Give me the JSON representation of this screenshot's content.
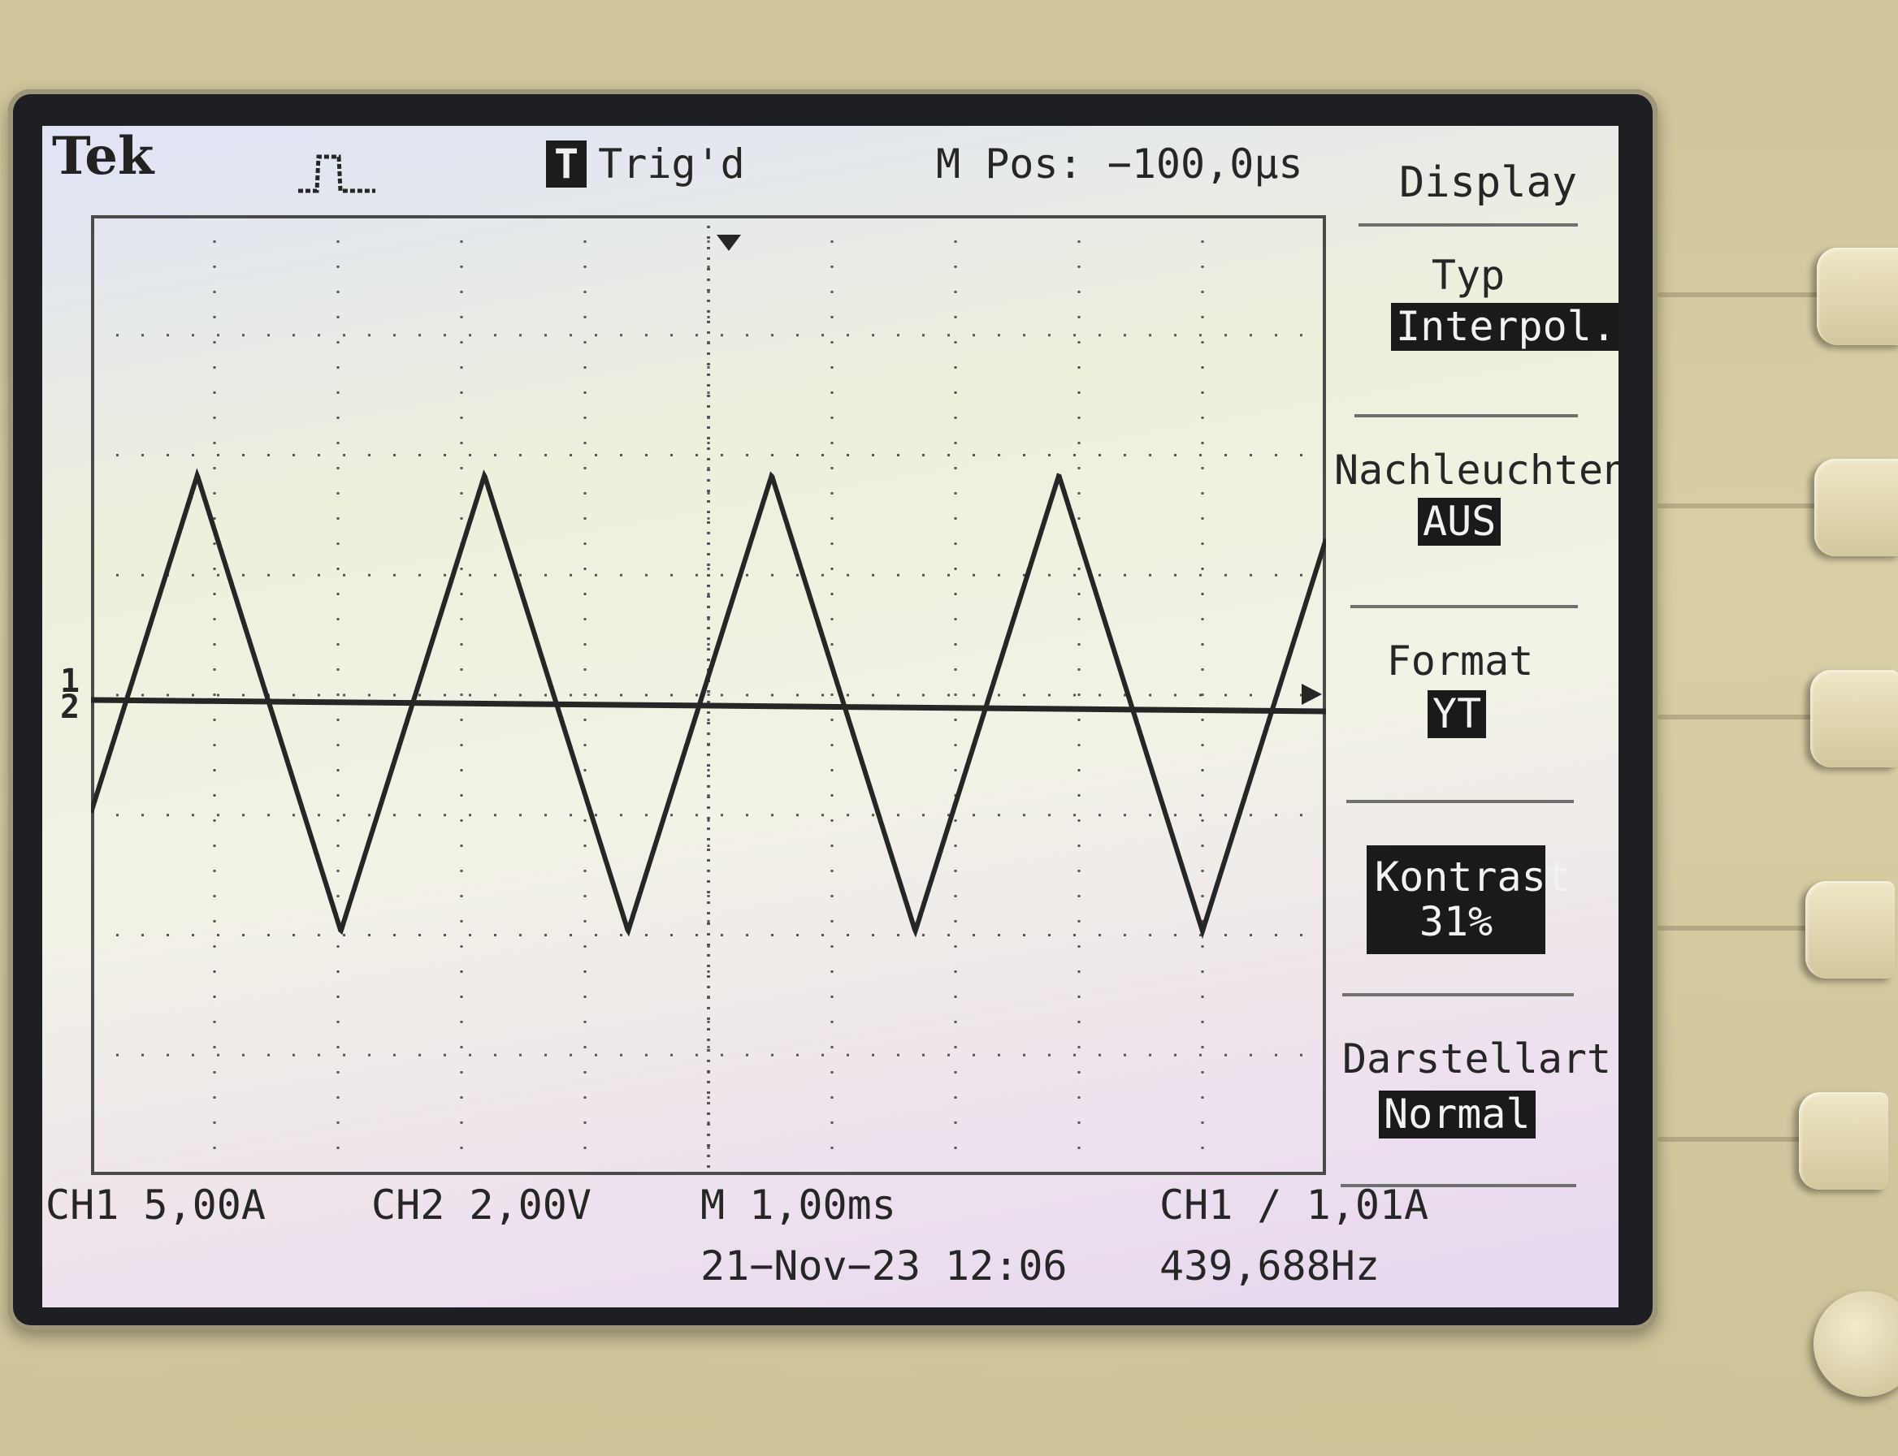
{
  "header": {
    "brand": "Tek",
    "trigger_badge": "T",
    "trigger_status": "Trig'd",
    "position": "M Pos: −100,0µs"
  },
  "channel_markers": {
    "ch1": "1",
    "ch2": "2"
  },
  "menu": {
    "title": "Display",
    "items": [
      {
        "label": "Typ",
        "value": "Interpol."
      },
      {
        "label": "Nachleuchten",
        "value": "AUS"
      },
      {
        "label": "Format",
        "value": "YT"
      },
      {
        "label": "Kontrast",
        "value": "31%"
      },
      {
        "label": "Darstellart",
        "value": "Normal"
      }
    ]
  },
  "status": {
    "ch1_scale": "CH1  5,00A",
    "ch2_scale": "CH2  2,00V",
    "timebase": "M 1,00ms",
    "trigger": "CH1 ∕ 1,01A",
    "datetime": "21−Nov−23 12:06",
    "frequency": "439,688Hz"
  },
  "waveform": {
    "ch1_shape": "triangle",
    "ch1_color": "#262626",
    "ch1_peak_div": 1.9,
    "ch1_cycles_visible": 4.3,
    "ch2_level_div": 0.0
  },
  "colors": {
    "lcd_text": "#262626",
    "inverted_bg": "#1a1a1a",
    "housing": "#d3c89e",
    "bezel": "#1e1f22"
  }
}
